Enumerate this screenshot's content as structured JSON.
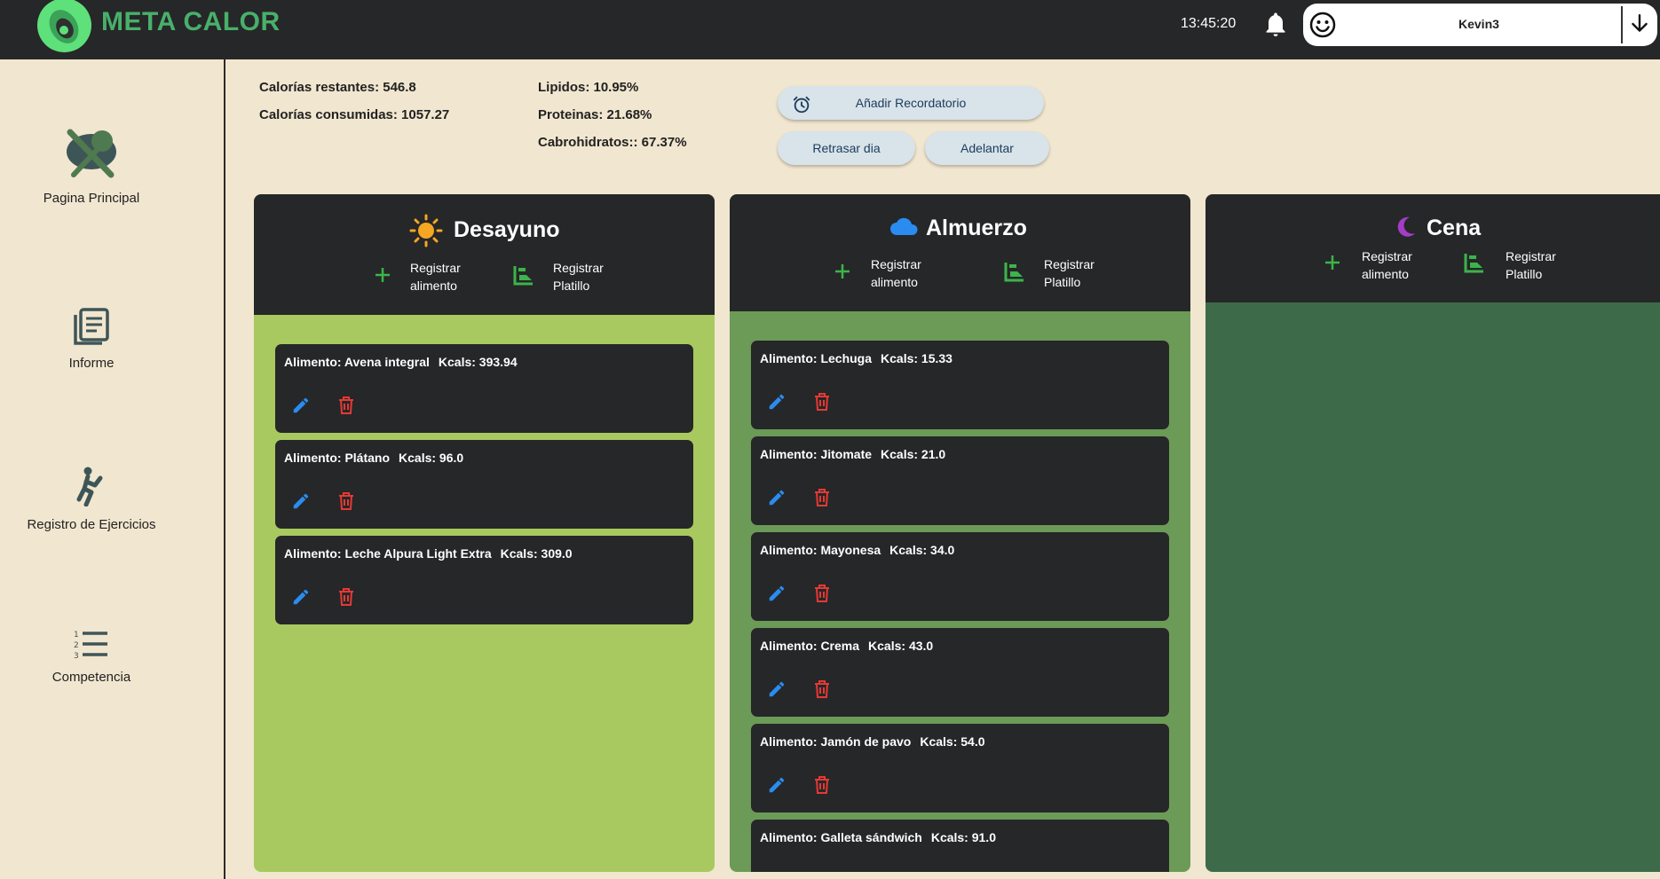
{
  "app": {
    "name": "META CALOR"
  },
  "header": {
    "time": "13:45:20",
    "user": "Kevin3"
  },
  "sidebar": {
    "items": [
      {
        "label": "Pagina Principal",
        "icon": "home-salad-icon"
      },
      {
        "label": "Informe",
        "icon": "report-icon"
      },
      {
        "label": "Registro de Ejercicios",
        "icon": "exercise-icon"
      },
      {
        "label": "Competencia",
        "icon": "ranking-list-icon"
      }
    ]
  },
  "stats": {
    "remaining": "Calorías restantes: 546.8",
    "consumed": "Calorías consumidas: 1057.27",
    "lipids": "Lipidos: 10.95%",
    "proteins": "Proteinas: 21.68%",
    "carbs": "Cabrohidratos:: 67.37%"
  },
  "actions": {
    "reminder": "Añadir Recordatorio",
    "prev_day": "Retrasar dia",
    "next_day": "Adelantar"
  },
  "meals": [
    {
      "title": "Desayuno",
      "icon": "sun-icon",
      "register_food": [
        "Registrar",
        "alimento"
      ],
      "register_dish": [
        "Registrar",
        "Platillo"
      ],
      "items": [
        {
          "label": "Alimento: Avena integral",
          "kcal": "Kcals: 393.94"
        },
        {
          "label": "Alimento: Plátano",
          "kcal": "Kcals: 96.0"
        },
        {
          "label": "Alimento: Leche Alpura Light Extra",
          "kcal": "Kcals: 309.0"
        }
      ]
    },
    {
      "title": "Almuerzo",
      "icon": "cloud-icon",
      "register_food": [
        "Registrar",
        "alimento"
      ],
      "register_dish": [
        "Registrar",
        "Platillo"
      ],
      "items": [
        {
          "label": "Alimento: Lechuga",
          "kcal": "Kcals: 15.33"
        },
        {
          "label": "Alimento: Jitomate",
          "kcal": "Kcals: 21.0"
        },
        {
          "label": "Alimento: Mayonesa",
          "kcal": "Kcals: 34.0"
        },
        {
          "label": "Alimento: Crema",
          "kcal": "Kcals: 43.0"
        },
        {
          "label": "Alimento: Jamón de pavo",
          "kcal": "Kcals: 54.0"
        },
        {
          "label": "Alimento: Galleta sándwich",
          "kcal": "Kcals: 91.0"
        }
      ]
    },
    {
      "title": "Cena",
      "icon": "moon-icon",
      "register_food": [
        "Registrar",
        "alimento"
      ],
      "register_dish": [
        "Registrar",
        "Platillo"
      ],
      "items": []
    }
  ],
  "colors": {
    "topbar": "#262728",
    "background": "#f1e6cf",
    "breakfast_body": "#a8c95f",
    "lunch_body": "#6b9b57",
    "dinner_body": "#3d6b4a",
    "edit": "#2a8cf0",
    "delete": "#e53935"
  }
}
